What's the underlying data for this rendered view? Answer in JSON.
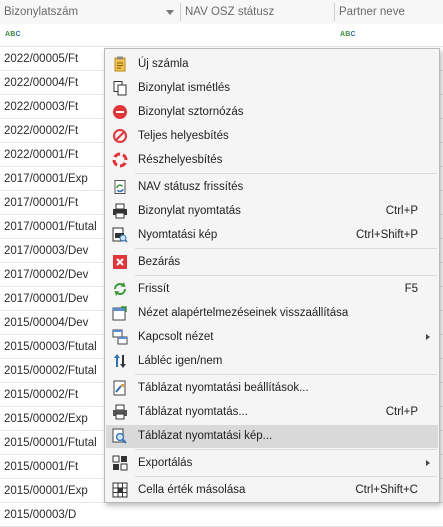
{
  "grid": {
    "columns": [
      "Bizonylatszám",
      "NAV OSZ státusz",
      "Partner neve"
    ],
    "rows": [
      "2022/00005/Ft",
      "2022/00004/Ft",
      "2022/00003/Ft",
      "2022/00002/Ft",
      "2022/00001/Ft",
      "2017/00001/Exp",
      "2017/00001/Ft",
      "2017/00001/Ftutal",
      "2017/00003/Dev",
      "2017/00002/Dev",
      "2017/00001/Dev",
      "2015/00004/Dev",
      "2015/00003/Ftutal",
      "2015/00002/Ftutal",
      "2015/00002/Ft",
      "2015/00002/Exp",
      "2015/00001/Ftutal",
      "2015/00001/Ft",
      "2015/00001/Exp",
      "2015/00003/D"
    ],
    "filter_icon_text": [
      "A",
      "B",
      "C"
    ]
  },
  "menu": {
    "items": [
      {
        "label": "Új számla",
        "shortcut": "",
        "icon": "new-invoice-icon"
      },
      {
        "label": "Bizonylat ismétlés",
        "shortcut": "",
        "icon": "copy-document-icon"
      },
      {
        "label": "Bizonylat sztornózás",
        "shortcut": "",
        "icon": "minus-circle-icon"
      },
      {
        "label": "Teljes helyesbítés",
        "shortcut": "",
        "icon": "prohibited-icon"
      },
      {
        "label": "Részhelyesbítés",
        "shortcut": "",
        "icon": "lifebuoy-icon"
      },
      {
        "label": "NAV státusz frissítés",
        "shortcut": "",
        "icon": "refresh-document-icon"
      },
      {
        "label": "Bizonylat nyomtatás",
        "shortcut": "Ctrl+P",
        "icon": "printer-icon"
      },
      {
        "label": "Nyomtatási kép",
        "shortcut": "Ctrl+Shift+P",
        "icon": "print-preview-icon"
      },
      {
        "label": "Bezárás",
        "shortcut": "",
        "icon": "close-red-icon"
      },
      {
        "label": "Frissít",
        "shortcut": "F5",
        "icon": "refresh-icon"
      },
      {
        "label": "Nézet alapértelmezéseinek visszaállítása",
        "shortcut": "",
        "icon": "reset-view-icon"
      },
      {
        "label": "Kapcsolt nézet",
        "shortcut": "",
        "icon": "linked-view-icon",
        "submenu": true
      },
      {
        "label": "Lábléc igen/nem",
        "shortcut": "",
        "icon": "sort-arrows-icon"
      },
      {
        "label": "Táblázat nyomtatási beállítások...",
        "shortcut": "",
        "icon": "print-settings-icon"
      },
      {
        "label": "Táblázat nyomtatás...",
        "shortcut": "Ctrl+P",
        "icon": "table-printer-icon"
      },
      {
        "label": "Táblázat nyomtatási kép...",
        "shortcut": "",
        "icon": "table-preview-icon",
        "highlighted": true
      },
      {
        "label": "Exportálás",
        "shortcut": "",
        "icon": "export-icon",
        "submenu": true
      },
      {
        "label": "Cella érték másolása",
        "shortcut": "Ctrl+Shift+C",
        "icon": "copy-cell-icon"
      }
    ]
  },
  "colors": {
    "highlight": "#d9d9d9",
    "danger": "#e0353a",
    "green": "#3a9a3a",
    "blue": "#2f6fb3"
  }
}
